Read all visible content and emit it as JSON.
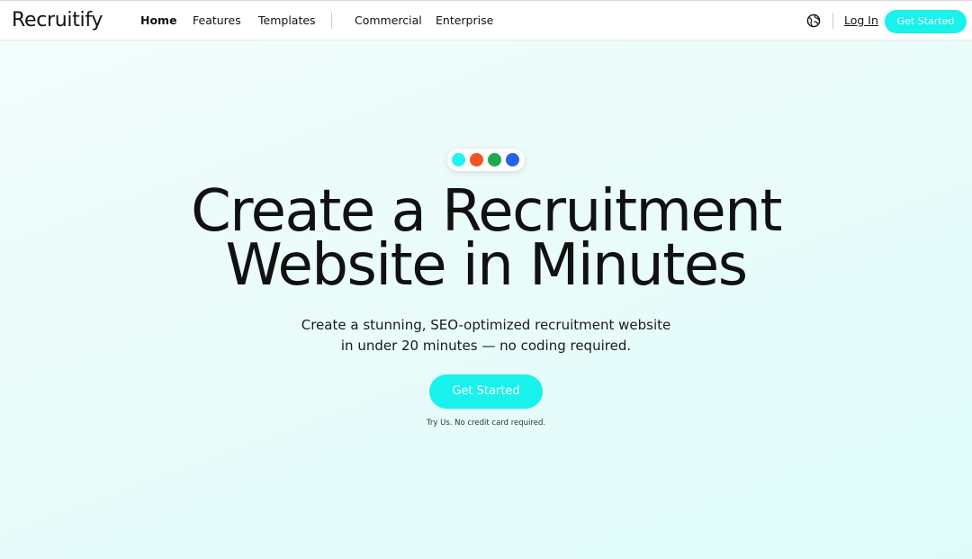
{
  "nav": {
    "logo": "Recruitify",
    "links": [
      {
        "label": "Home",
        "active": true
      },
      {
        "label": "Features"
      },
      {
        "label": "Templates"
      },
      {
        "label": "Commercial"
      },
      {
        "label": "Enterprise"
      }
    ],
    "language_icon": "globe-icon",
    "login": "Log In",
    "cta": "Get Started"
  },
  "hero": {
    "dot_colors": [
      "#1ff5ee",
      "#f2531d",
      "#20a94d",
      "#2563eb"
    ],
    "headline": [
      "Create a Recruitment",
      "Website in Minutes"
    ],
    "subtext": [
      "Create a stunning, SEO-optimized recruitment website",
      "in under 20 minutes — no coding required."
    ],
    "cta": "Get Started",
    "fineprint": "Try Us. No credit card required."
  },
  "colors": {
    "accent": "#19f1ec",
    "text": "#111111"
  }
}
